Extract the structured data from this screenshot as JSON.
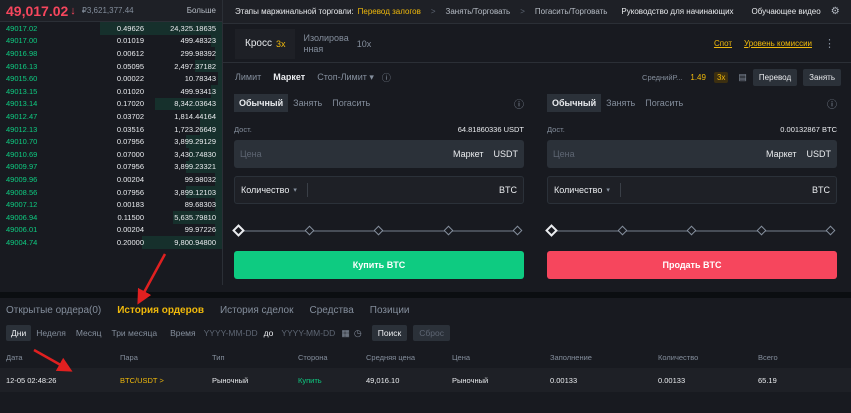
{
  "orderbook": {
    "last_price": "49,017.02",
    "arrow": "↓",
    "fiat_price": "₽3,621,377.44",
    "more_label": "Больше",
    "rows": [
      {
        "price": "49017.02",
        "amount": "0.49626",
        "total": "24,325.18635",
        "depth": 0.55
      },
      {
        "price": "49017.00",
        "amount": "0.01019",
        "total": "499.48323",
        "depth": 0.05
      },
      {
        "price": "49016.98",
        "amount": "0.00612",
        "total": "299.98392",
        "depth": 0.03
      },
      {
        "price": "49016.13",
        "amount": "0.05095",
        "total": "2,497.37182",
        "depth": 0.12
      },
      {
        "price": "49015.60",
        "amount": "0.00022",
        "total": "10.78343",
        "depth": 0.02
      },
      {
        "price": "49013.15",
        "amount": "0.01020",
        "total": "499.93413",
        "depth": 0.05
      },
      {
        "price": "49013.14",
        "amount": "0.17020",
        "total": "8,342.03643",
        "depth": 0.3
      },
      {
        "price": "49012.47",
        "amount": "0.03702",
        "total": "1,814.44164",
        "depth": 0.1
      },
      {
        "price": "49012.13",
        "amount": "0.03516",
        "total": "1,723.26649",
        "depth": 0.1
      },
      {
        "price": "49010.70",
        "amount": "0.07956",
        "total": "3,899.29129",
        "depth": 0.16
      },
      {
        "price": "49010.69",
        "amount": "0.07000",
        "total": "3,430.74830",
        "depth": 0.15
      },
      {
        "price": "49009.97",
        "amount": "0.07956",
        "total": "3,899.23321",
        "depth": 0.16
      },
      {
        "price": "49009.96",
        "amount": "0.00204",
        "total": "99.98032",
        "depth": 0.03
      },
      {
        "price": "49008.56",
        "amount": "0.07956",
        "total": "3,899.12103",
        "depth": 0.16
      },
      {
        "price": "49007.12",
        "amount": "0.00183",
        "total": "89.68303",
        "depth": 0.03
      },
      {
        "price": "49006.94",
        "amount": "0.11500",
        "total": "5,635.79810",
        "depth": 0.22
      },
      {
        "price": "49006.01",
        "amount": "0.00204",
        "total": "99.97226",
        "depth": 0.03
      },
      {
        "price": "49004.74",
        "amount": "0.20000",
        "total": "9,800.94800",
        "depth": 0.36
      }
    ]
  },
  "topbar": {
    "stages_label": "Этапы маржинальной торговли:",
    "step1": "Перевод залогов",
    "step2": "Занять/Торговать",
    "step3": "Погасить/Торговать",
    "sep": ">",
    "guide": "Руководство для начинающих",
    "video": "Обучающее видео",
    "gear_icon": "⚙"
  },
  "mode": {
    "cross_label": "Кросс",
    "cross_lev": "3x",
    "isolated_line1": "Изолирова",
    "isolated_line2": "нная",
    "isolated_lev": "10x",
    "transfer_link": "Спот",
    "fee_link": "Уровень комиссии",
    "kebab": "⋮"
  },
  "order_types": {
    "limit": "Лимит",
    "market": "Маркет",
    "stop_limit": "Стоп-Лимит",
    "stop_caret": "▾",
    "info": "ⓘ",
    "avg_label": "СреднийР...",
    "avg_value": "1.49",
    "avg_badge": "3x",
    "calc_icon": "▤",
    "transfer_btn": "Перевод",
    "borrow_btn": "Занять"
  },
  "buy_panel": {
    "tabs": [
      "Обычный",
      "Занять",
      "Погасить"
    ],
    "info": "ⓘ",
    "avail_label": "Дост.",
    "avail_value": "64.81860336 USDT",
    "price_placeholder": "Цена",
    "price_mode": "Маркет",
    "price_unit": "USDT",
    "qty_label": "Количество",
    "qty_caret": "▾",
    "qty_unit": "BTC",
    "action": "Купить BTC"
  },
  "sell_panel": {
    "tabs": [
      "Обычный",
      "Занять",
      "Погасить"
    ],
    "info": "ⓘ",
    "avail_label": "Дост.",
    "avail_value": "0.00132867 BTC",
    "price_placeholder": "Цена",
    "price_mode": "Маркет",
    "price_unit": "USDT",
    "qty_label": "Количество",
    "qty_caret": "▾",
    "qty_unit": "BTC",
    "action": "Продать BTC"
  },
  "bottom": {
    "tabs": [
      "Открытые ордера(0)",
      "История ордеров",
      "История сделок",
      "Средства",
      "Позиции"
    ],
    "filters": [
      "Дни",
      "Неделя",
      "Месяц",
      "Три месяца"
    ],
    "time_label": "Время",
    "date_from_placeholder": "YYYY-MM-DD",
    "to_label": "до",
    "date_to_placeholder": "YYYY-MM-DD",
    "cal_icon": "▦",
    "clock_icon": "◷",
    "search_btn": "Поиск",
    "reset_btn": "Сброс",
    "columns": [
      "Дата",
      "Пара",
      "Тип",
      "Сторона",
      "Средняя цена",
      "Цена",
      "Заполнение",
      "Количество",
      "Всего"
    ],
    "rows": [
      {
        "date": "12-05 02:48:26",
        "pair": "BTC/USDT >",
        "type": "Рыночный",
        "side": "Купить",
        "avg_price": "49,016.10",
        "price": "Рыночный",
        "filled": "0.00133",
        "amount": "0.00133",
        "total": "65.19"
      }
    ]
  },
  "colors": {
    "background": "#181a20",
    "accent": "#f0b90b",
    "buy": "#0ecb81",
    "sell": "#f6465d",
    "annotation_arrow": "#e02020"
  }
}
